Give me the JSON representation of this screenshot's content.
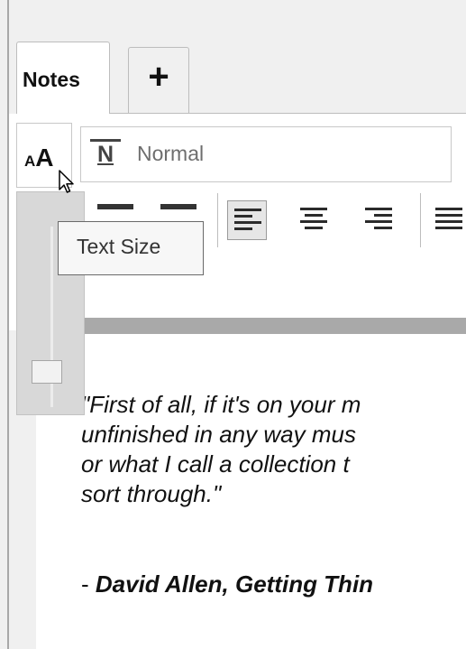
{
  "tabs": [
    {
      "label": "Notes",
      "active": true
    },
    {
      "label": "+"
    }
  ],
  "toolbar": {
    "text_size_label_small": "A",
    "text_size_label_big": "A",
    "style_icon_letter": "N",
    "style_value": "Normal",
    "text_size_tooltip": "Text Size",
    "text_size_slider_value": 0.25
  },
  "note": {
    "quote_lines": [
      "\"First of all, if it's on your m",
      "unfinished in any way mus",
      "or what I call a collection t",
      "sort through.\""
    ],
    "attribution_prefix": "- ",
    "attribution": "David Allen, Getting Thin"
  },
  "colors": {
    "background": "#f0f0f0",
    "panel": "#ffffff",
    "border": "#bdbdbd",
    "active_button": "#e6e6e6"
  }
}
